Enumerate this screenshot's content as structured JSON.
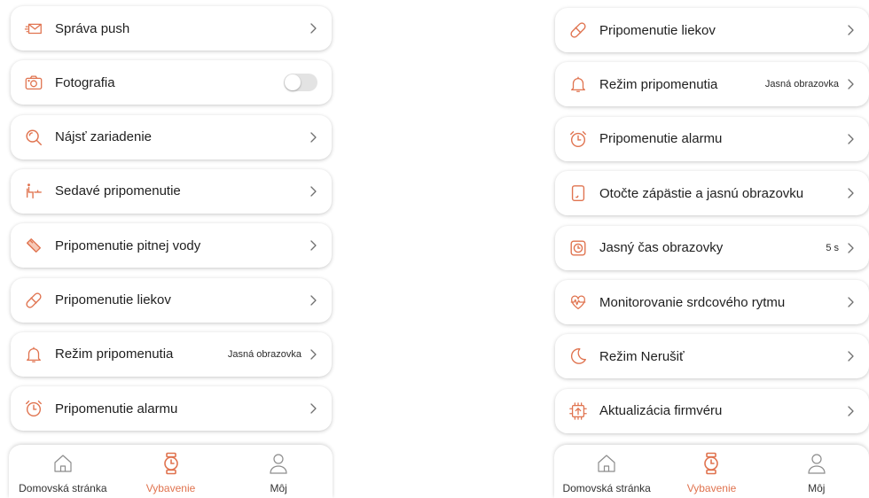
{
  "colors": {
    "accent": "#e0734f",
    "icon": "#e0734f",
    "text": "#1f1f1f",
    "tab_inactive": "#333333"
  },
  "left": {
    "items": [
      {
        "label": "Správa push",
        "icon": "envelope-icon",
        "value": "",
        "control": "chevron"
      },
      {
        "label": "Fotografia",
        "icon": "camera-icon",
        "value": "",
        "control": "toggle",
        "toggle_on": false
      },
      {
        "label": "Nájsť zariadenie",
        "icon": "search-icon",
        "value": "",
        "control": "chevron"
      },
      {
        "label": "Sedavé pripomenutie",
        "icon": "sitting-icon",
        "value": "",
        "control": "chevron"
      },
      {
        "label": "Pripomenutie pitnej vody",
        "icon": "water-cup-icon",
        "value": "",
        "control": "chevron"
      },
      {
        "label": "Pripomenutie liekov",
        "icon": "pill-icon",
        "value": "",
        "control": "chevron"
      },
      {
        "label": "Režim pripomenutia",
        "icon": "bell-icon",
        "value": "Jasná obrazovka",
        "control": "chevron"
      },
      {
        "label": "Pripomenutie alarmu",
        "icon": "alarm-clock-icon",
        "value": "",
        "control": "chevron"
      }
    ]
  },
  "right": {
    "items": [
      {
        "label": "Pripomenutie liekov",
        "icon": "pill-icon",
        "value": "",
        "control": "chevron"
      },
      {
        "label": "Režim pripomenutia",
        "icon": "bell-icon",
        "value": "Jasná obrazovka",
        "control": "chevron"
      },
      {
        "label": "Pripomenutie alarmu",
        "icon": "alarm-clock-icon",
        "value": "",
        "control": "chevron"
      },
      {
        "label": "Otočte zápästie a jasnú obrazovku",
        "icon": "wrist-screen-icon",
        "value": "",
        "control": "chevron"
      },
      {
        "label": "Jasný čas obrazovky",
        "icon": "screen-time-icon",
        "value": "5 s",
        "control": "chevron"
      },
      {
        "label": "Monitorovanie srdcového rytmu",
        "icon": "heart-rate-icon",
        "value": "",
        "control": "chevron"
      },
      {
        "label": "Režim Nerušiť",
        "icon": "moon-icon",
        "value": "",
        "control": "chevron"
      },
      {
        "label": "Aktualizácia firmvéru",
        "icon": "firmware-update-icon",
        "value": "",
        "control": "chevron"
      }
    ]
  },
  "tabs": [
    {
      "label": "Domovská stránka",
      "icon": "home-icon",
      "active": false
    },
    {
      "label": "Vybavenie",
      "icon": "watch-icon",
      "active": true
    },
    {
      "label": "Môj",
      "icon": "user-icon",
      "active": false
    }
  ]
}
